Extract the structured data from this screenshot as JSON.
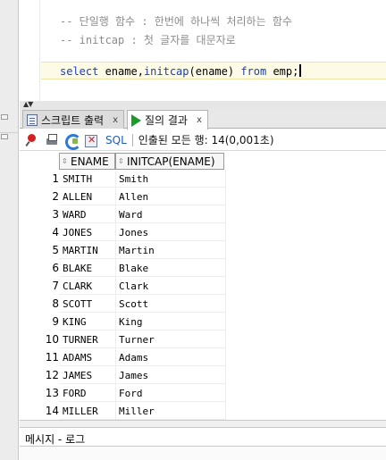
{
  "editor": {
    "comment1": "-- 단일행 함수 : 한번에 하나씩 처리하는 함수",
    "comment2": "-- initcap : 첫 글자를 대문자로",
    "query": {
      "kw_select": "select",
      "part1": " ename,",
      "fn": "initcap",
      "part2": "(ename) ",
      "kw_from": "from",
      "part3": " emp;"
    }
  },
  "tabs": [
    {
      "label": "스크립트 출력",
      "close": "x"
    },
    {
      "label": "질의 결과",
      "close": "x"
    }
  ],
  "toolbar": {
    "sql_label": "SQL",
    "status": "인출된 모든 행: 14(0,001초)"
  },
  "grid": {
    "columns": [
      "ENAME",
      "INITCAP(ENAME)"
    ],
    "rows": [
      {
        "n": "1",
        "ename": "SMITH",
        "initcap": "Smith"
      },
      {
        "n": "2",
        "ename": "ALLEN",
        "initcap": "Allen"
      },
      {
        "n": "3",
        "ename": "WARD",
        "initcap": "Ward"
      },
      {
        "n": "4",
        "ename": "JONES",
        "initcap": "Jones"
      },
      {
        "n": "5",
        "ename": "MARTIN",
        "initcap": "Martin"
      },
      {
        "n": "6",
        "ename": "BLAKE",
        "initcap": "Blake"
      },
      {
        "n": "7",
        "ename": "CLARK",
        "initcap": "Clark"
      },
      {
        "n": "8",
        "ename": "SCOTT",
        "initcap": "Scott"
      },
      {
        "n": "9",
        "ename": "KING",
        "initcap": "King"
      },
      {
        "n": "10",
        "ename": "TURNER",
        "initcap": "Turner"
      },
      {
        "n": "11",
        "ename": "ADAMS",
        "initcap": "Adams"
      },
      {
        "n": "12",
        "ename": "JAMES",
        "initcap": "James"
      },
      {
        "n": "13",
        "ename": "FORD",
        "initcap": "Ford"
      },
      {
        "n": "14",
        "ename": "MILLER",
        "initcap": "Miller"
      }
    ]
  },
  "messages": {
    "title": "메시지 - 로그"
  },
  "colors": {
    "keyword": "#1a3cb8",
    "comment": "#8c8c8c",
    "current_line": "#fdfae6",
    "play_green": "#1e9a2c"
  }
}
